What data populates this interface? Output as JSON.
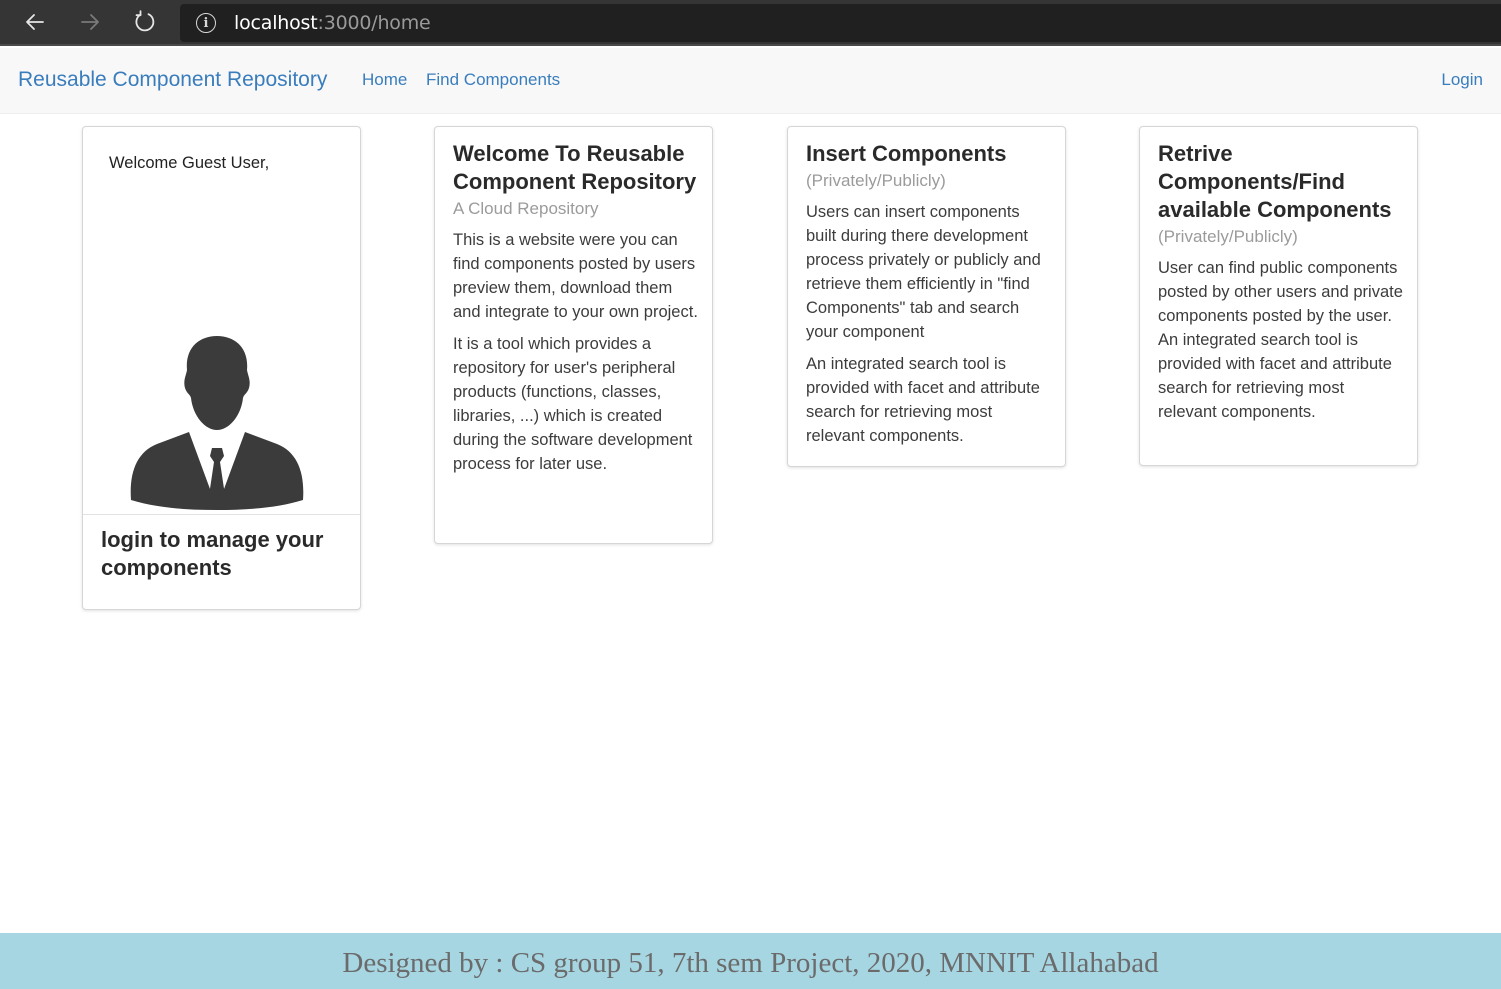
{
  "browser": {
    "url_host": "localhost",
    "url_path": ":3000/home"
  },
  "navbar": {
    "brand": "Reusable Component Repository",
    "links": [
      "Home",
      "Find Components"
    ],
    "login": "Login"
  },
  "user_card": {
    "welcome": "Welcome Guest User,",
    "login_prompt": "login to manage your components"
  },
  "cards": [
    {
      "title": "Welcome To Reusable Component Repository",
      "subtitle": "A Cloud Repository",
      "paragraphs": [
        "This is a website were you can find components posted by users preview them, download them and integrate to your own project.",
        "It is a tool which provides a repository for user's peripheral products (functions, classes, libraries, ...) which is created during the software development process for later use."
      ]
    },
    {
      "title": "Insert Components",
      "subtitle": "(Privately/Publicly)",
      "paragraphs": [
        "Users can insert components built during there development process privately or publicly and retrieve them efficiently in \"find Components\" tab and search your component",
        "An integrated search tool is provided with facet and attribute search for retrieving most relevant components."
      ]
    },
    {
      "title": "Retrive Components/Find available Components",
      "subtitle": "(Privately/Publicly)",
      "paragraphs": [
        "User can find public components posted by other users and private components posted by the user. An integrated search tool is provided with facet and attribute search for retrieving most relevant components."
      ]
    }
  ],
  "footer": {
    "text": "Designed by : CS group 51, 7th sem Project, 2020, MNNIT Allahabad"
  },
  "icons": {
    "back": "back-arrow-icon",
    "forward": "forward-arrow-icon",
    "reload": "reload-icon",
    "info": "info-icon",
    "avatar": "user-avatar-icon"
  },
  "colors": {
    "link": "#3a7dbc",
    "footer_bg": "#a7d6e3",
    "browser_bar": "#353535"
  }
}
